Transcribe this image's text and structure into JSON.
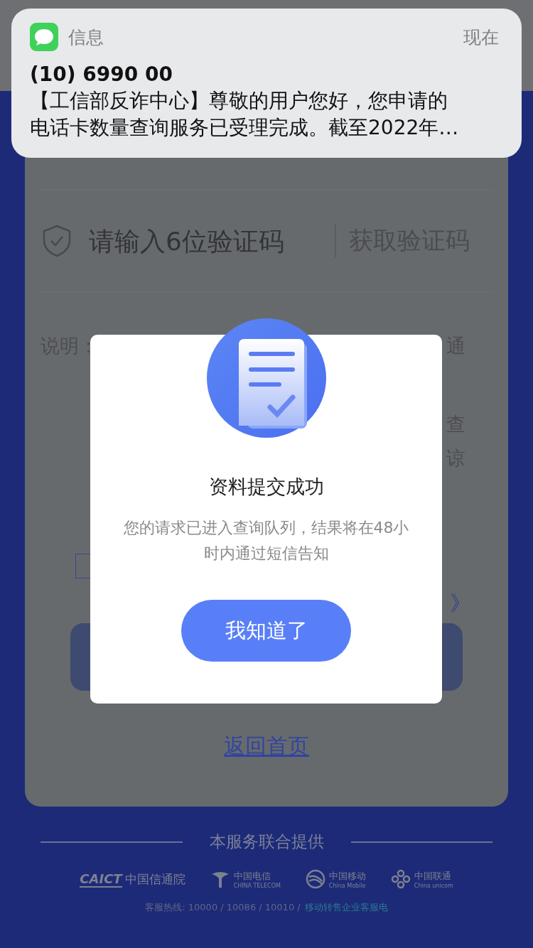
{
  "notification": {
    "app": "信息",
    "time": "现在",
    "sender": "(10) 6990 00",
    "body": "【工信部反诈中心】尊敬的用户您好，您申请的电话卡数量查询服务已受理完成。截至2022年…"
  },
  "form": {
    "code_field": {
      "placeholder": "请输入6位验证码"
    },
    "get_code_button": "获取验证码",
    "notes": [
      {
        "left": "说明：",
        "right": "通"
      },
      {
        "right": "查"
      },
      {
        "right": "谅"
      }
    ],
    "agreement": {
      "link_end": "》"
    },
    "home_link": "返回首页"
  },
  "dialog": {
    "title": "资料提交成功",
    "message": "您的请求已进入查询队列，结果将在48小时内通过短信告知",
    "button": "我知道了"
  },
  "footer": {
    "title": "本服务联合提供",
    "partners": [
      {
        "kind": "caict",
        "mark": "CAICT",
        "name": "中国信通院"
      },
      {
        "kind": "telecom",
        "name": "中国电信",
        "subtitle": "CHINA TELECOM"
      },
      {
        "kind": "mobile",
        "name": "中国移动",
        "subtitle": "China Mobile"
      },
      {
        "kind": "unicom",
        "name": "中国联通",
        "subtitle": "China unicom"
      }
    ],
    "hotline": "客服热线: 10000 / 10086 / 10010 /",
    "hotline_link": "移动转售企业客服电"
  }
}
